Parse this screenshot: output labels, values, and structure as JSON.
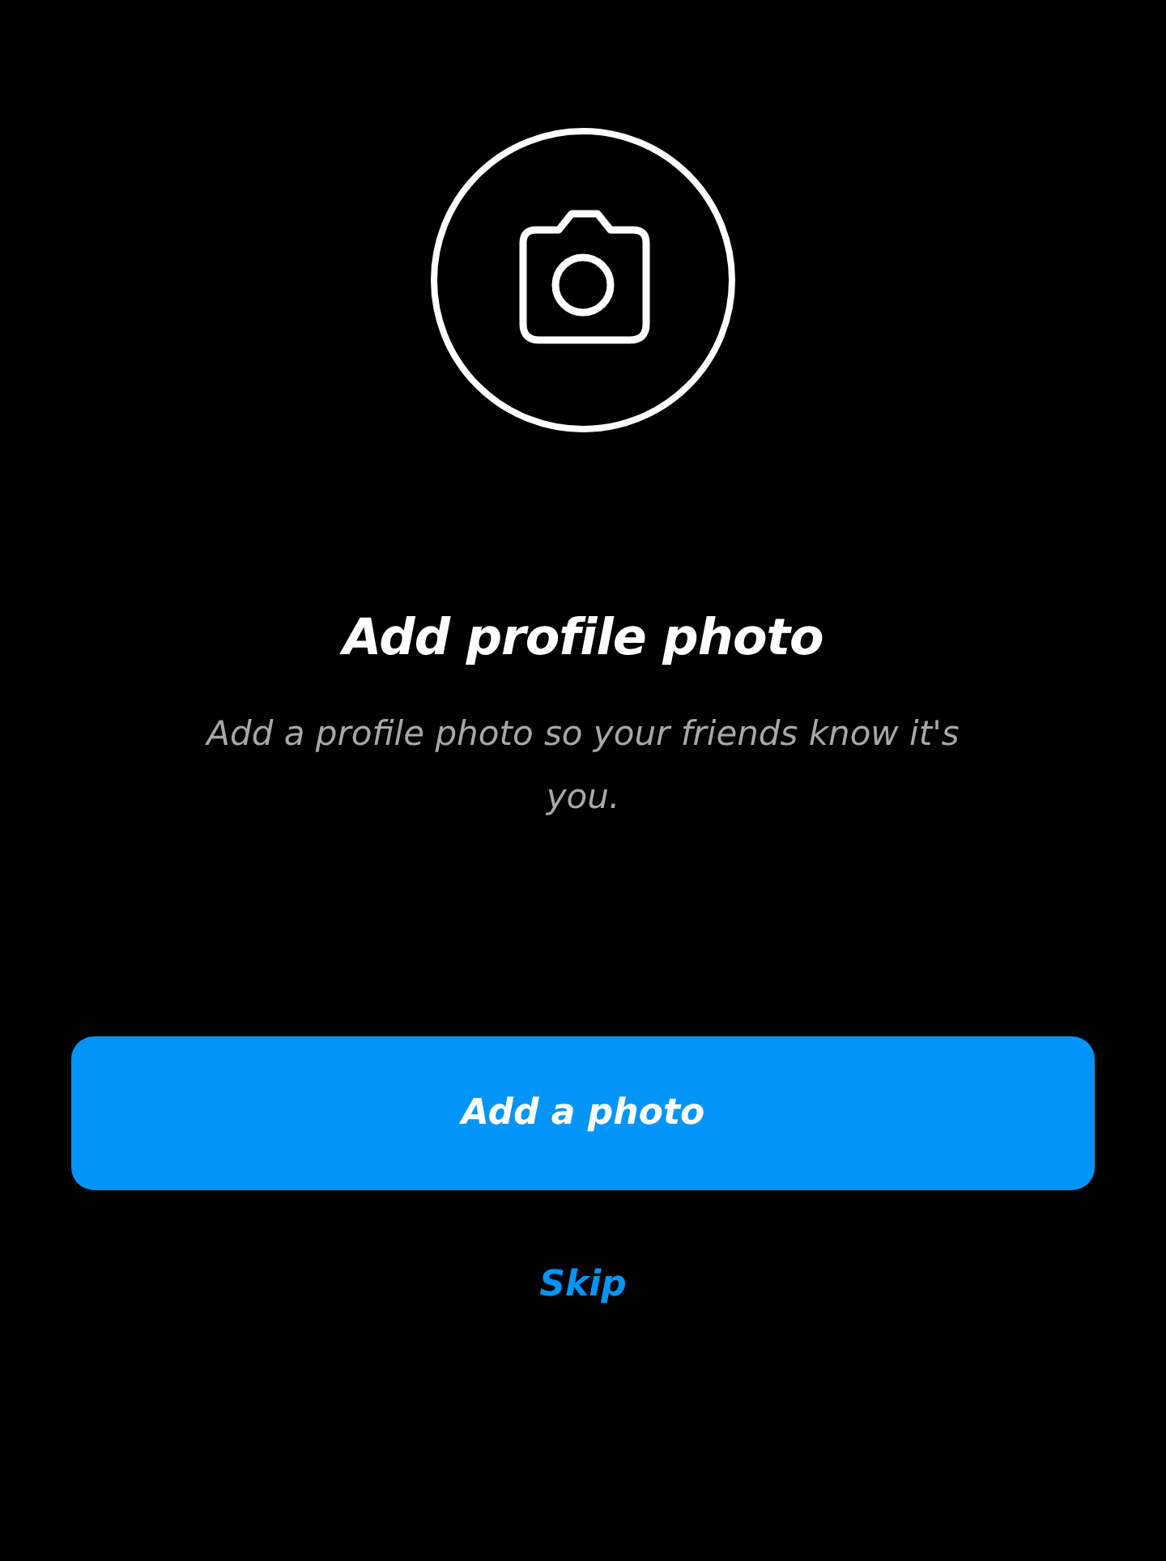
{
  "title": "Add profile photo",
  "description": "Add a profile photo so your friends know it's you.",
  "primary_button": {
    "label": "Add a photo"
  },
  "skip_link": {
    "label": "Skip"
  }
}
